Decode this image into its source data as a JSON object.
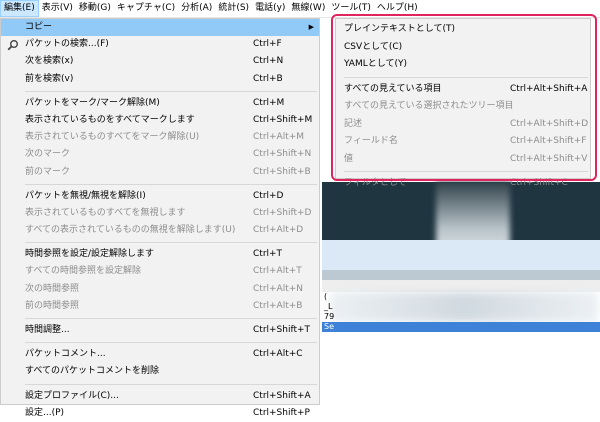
{
  "menubar": [
    {
      "label": "編集(E)",
      "active": true
    },
    {
      "label": "表示(V)"
    },
    {
      "label": "移動(G)"
    },
    {
      "label": "キャプチャ(C)"
    },
    {
      "label": "分析(A)"
    },
    {
      "label": "統計(S)"
    },
    {
      "label": "電話(y)"
    },
    {
      "label": "無線(W)"
    },
    {
      "label": "ツール(T)"
    },
    {
      "label": "ヘルプ(H)"
    }
  ],
  "edit_menu": {
    "copy": {
      "label": "コピー"
    },
    "find_packet": {
      "label": "パケットの検索...(F)",
      "shortcut": "Ctrl+F"
    },
    "find_next": {
      "label": "次を検索(x)",
      "shortcut": "Ctrl+N"
    },
    "find_prev": {
      "label": "前を検索(v)",
      "shortcut": "Ctrl+B"
    },
    "mark_toggle": {
      "label": "パケットをマーク/マーク解除(M)",
      "shortcut": "Ctrl+M"
    },
    "mark_all_displayed": {
      "label": "表示されているものをすべてマークします",
      "shortcut": "Ctrl+Shift+M"
    },
    "unmark_all_displayed": {
      "label": "表示されているものすべてをマーク解除(U)",
      "shortcut": "Ctrl+Alt+M"
    },
    "next_mark": {
      "label": "次のマーク",
      "shortcut": "Ctrl+Shift+N"
    },
    "prev_mark": {
      "label": "前のマーク",
      "shortcut": "Ctrl+Shift+B"
    },
    "ignore_toggle": {
      "label": "パケットを無視/無視を解除(I)",
      "shortcut": "Ctrl+D"
    },
    "ignore_all_displayed": {
      "label": "表示されているものすべてを無視します",
      "shortcut": "Ctrl+Shift+D"
    },
    "unignore_all_displayed": {
      "label": "すべての表示されているものの無視を解除します(U)",
      "shortcut": "Ctrl+Alt+D"
    },
    "time_ref_toggle": {
      "label": "時間参照を設定/設定解除します",
      "shortcut": "Ctrl+T"
    },
    "unset_all_time_refs": {
      "label": "すべての時間参照を設定解除",
      "shortcut": "Ctrl+Alt+T"
    },
    "next_time_ref": {
      "label": "次の時間参照",
      "shortcut": "Ctrl+Alt+N"
    },
    "prev_time_ref": {
      "label": "前の時間参照",
      "shortcut": "Ctrl+Alt+B"
    },
    "time_shift": {
      "label": "時間調整...",
      "shortcut": "Ctrl+Shift+T"
    },
    "packet_comment": {
      "label": "パケットコメント...",
      "shortcut": "Ctrl+Alt+C"
    },
    "delete_all_comments": {
      "label": "すべてのパケットコメントを削除"
    },
    "config_profiles": {
      "label": "設定プロファイル(C)...",
      "shortcut": "Ctrl+Shift+A"
    },
    "preferences": {
      "label": "設定...(P)",
      "shortcut": "Ctrl+Shift+P"
    }
  },
  "copy_submenu": {
    "plain_text": {
      "label": "プレインテキストとして(T)"
    },
    "csv": {
      "label": "CSVとして(C)"
    },
    "yaml": {
      "label": "YAMLとして(Y)"
    },
    "all_visible_items": {
      "label": "すべての見えている項目",
      "shortcut": "Ctrl+Alt+Shift+A"
    },
    "all_visible_selected_tree": {
      "label": "すべての見えている選択されたツリー項目"
    },
    "description": {
      "label": "記述",
      "shortcut": "Ctrl+Alt+Shift+D"
    },
    "field_name": {
      "label": "フィールド名",
      "shortcut": "Ctrl+Alt+Shift+F"
    },
    "value": {
      "label": "値",
      "shortcut": "Ctrl+Alt+Shift+V"
    },
    "as_filter": {
      "label": "フィルタとして",
      "shortcut": "Ctrl+Shift+C"
    }
  },
  "background": {
    "rows": [
      "(",
      "_L",
      "79",
      "Se"
    ]
  },
  "colors": {
    "highlight": "#91c9f7",
    "callout": "#e0245e",
    "menu_bg": "#f2f2f2"
  }
}
